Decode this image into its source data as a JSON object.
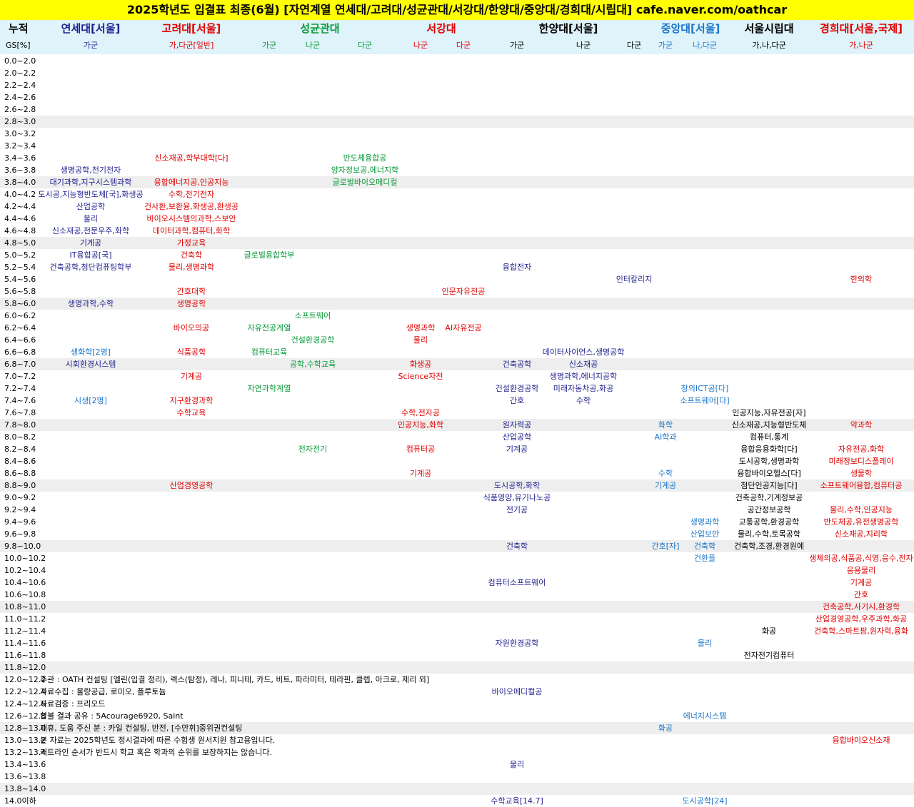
{
  "title": "2025학년도 입결표 최종(6월) [자연계열 연세대/고려대/성균관대/서강대/한양대/중앙대/경희대/시립대] cafe.naver.com/oathcar",
  "header": {
    "cumulative_label": "누적",
    "gs_label": "GS[%]",
    "universities": [
      {
        "key": "yonsei",
        "name": "연세대[서울]",
        "color": "#1f1f8f"
      },
      {
        "key": "korea",
        "name": "고려대[서울]",
        "color": "#e00000"
      },
      {
        "key": "skku",
        "name": "성균관대",
        "color": "#0a9a3a"
      },
      {
        "key": "sogang",
        "name": "서강대",
        "color": "#e00000"
      },
      {
        "key": "hanyang",
        "name": "한양대[서울]",
        "color": "#000000"
      },
      {
        "key": "chungang",
        "name": "중앙대[서울]",
        "color": "#1a75c9"
      },
      {
        "key": "uos",
        "name": "서울시립대",
        "color": "#000000"
      },
      {
        "key": "kyunghee",
        "name": "경희대[서울,국제]",
        "color": "#e00000"
      }
    ],
    "groups": [
      {
        "key": "yonsei_ga",
        "label": "가군"
      },
      {
        "key": "korea_ga",
        "label": "가,다군[일반]"
      },
      {
        "key": "skku_ga",
        "label": "가군"
      },
      {
        "key": "skku_na",
        "label": "나군"
      },
      {
        "key": "skku_da",
        "label": "다군"
      },
      {
        "key": "sogang_na",
        "label": "나군"
      },
      {
        "key": "sogang_da",
        "label": "다군"
      },
      {
        "key": "hanyang_ga",
        "label": "가군"
      },
      {
        "key": "hanyang_na",
        "label": "나군"
      },
      {
        "key": "hanyang_da",
        "label": "다군"
      },
      {
        "key": "chungang_ga",
        "label": "가군"
      },
      {
        "key": "chungang_nada",
        "label": "나,다군"
      },
      {
        "key": "uos",
        "label": "가,나,다군"
      },
      {
        "key": "kyunghee",
        "label": "가,나군"
      }
    ]
  },
  "ranges": [
    "0.0~2.0",
    "2.0~2.2",
    "2.2~2.4",
    "2.4~2.6",
    "2.6~2.8",
    "2.8~3.0",
    "3.0~3.2",
    "3.2~3.4",
    "3.4~3.6",
    "3.6~3.8",
    "3.8~4.0",
    "4.0~4.2",
    "4.2~4.4",
    "4.4~4.6",
    "4.6~4.8",
    "4.8~5.0",
    "5.0~5.2",
    "5.2~5.4",
    "5.4~5.6",
    "5.6~5.8",
    "5.8~6.0",
    "6.0~6.2",
    "6.2~6.4",
    "6.4~6.6",
    "6.6~6.8",
    "6.8~7.0",
    "7.0~7.2",
    "7.2~7.4",
    "7.4~7.6",
    "7.6~7.8",
    "7.8~8.0",
    "8.0~8.2",
    "8.2~8.4",
    "8.4~8.6",
    "8.6~8.8",
    "8.8~9.0",
    "9.0~9.2",
    "9.2~9.4",
    "9.4~9.6",
    "9.6~9.8",
    "9.8~10.0",
    "10.0~10.2",
    "10.2~10.4",
    "10.4~10.6",
    "10.6~10.8",
    "10.8~11.0",
    "11.0~11.2",
    "11.2~11.4",
    "11.4~11.6",
    "11.6~11.8",
    "11.8~12.0",
    "12.0~12.2",
    "12.2~12.4",
    "12.4~12.6",
    "12.6~12.8",
    "12.8~13.0",
    "13.0~13.2",
    "13.2~13.4",
    "13.4~13.6",
    "13.6~13.8",
    "13.8~14.0",
    "14.0이하"
  ],
  "shaded_rows": [
    5,
    10,
    15,
    20,
    25,
    30,
    35,
    40,
    45,
    50,
    55,
    60
  ],
  "cells": [
    {
      "row": 8,
      "col": "korea_ga",
      "text": "신소재공,학부대학[다]",
      "color": "#e00000"
    },
    {
      "row": 8,
      "col": "skku_da",
      "text": "반도체융합공",
      "color": "#0a9a3a"
    },
    {
      "row": 9,
      "col": "yonsei_ga",
      "text": "생명공학,전기전자",
      "color": "#1f1f8f"
    },
    {
      "row": 9,
      "col": "skku_da",
      "text": "양자정보공,에너지학",
      "color": "#0a9a3a"
    },
    {
      "row": 10,
      "col": "yonsei_ga",
      "text": "대기과학,지구시스템과학",
      "color": "#1f1f8f"
    },
    {
      "row": 10,
      "col": "korea_ga",
      "text": "융합에너지공,인공지능",
      "color": "#e00000"
    },
    {
      "row": 10,
      "col": "skku_da",
      "text": "글로벌바이오메디컬",
      "color": "#0a9a3a"
    },
    {
      "row": 11,
      "col": "yonsei_ga",
      "text": "도시공,지능형반도체[국],화생공",
      "color": "#1f1f8f"
    },
    {
      "row": 11,
      "col": "korea_ga",
      "text": "수학,전기전자",
      "color": "#e00000"
    },
    {
      "row": 12,
      "col": "yonsei_ga",
      "text": "산업공학",
      "color": "#1f1f8f"
    },
    {
      "row": 12,
      "col": "korea_ga",
      "text": "건사환,보환융,화생공,환생공",
      "color": "#e00000"
    },
    {
      "row": 13,
      "col": "yonsei_ga",
      "text": "물리",
      "color": "#1f1f8f"
    },
    {
      "row": 13,
      "col": "korea_ga",
      "text": "바이오시스템의과학,스보안",
      "color": "#e00000"
    },
    {
      "row": 14,
      "col": "yonsei_ga",
      "text": "신소재공,천문우주,화학",
      "color": "#1f1f8f"
    },
    {
      "row": 14,
      "col": "korea_ga",
      "text": "데이터과학,컴퓨터,화학",
      "color": "#e00000"
    },
    {
      "row": 15,
      "col": "yonsei_ga",
      "text": "기계공",
      "color": "#1f1f8f"
    },
    {
      "row": 15,
      "col": "korea_ga",
      "text": "가정교육",
      "color": "#e00000"
    },
    {
      "row": 16,
      "col": "yonsei_ga",
      "text": "IT융합공[국]",
      "color": "#1f1f8f"
    },
    {
      "row": 16,
      "col": "korea_ga",
      "text": "건축학",
      "color": "#e00000"
    },
    {
      "row": 16,
      "col": "skku_ga",
      "text": "글로벌융합학부",
      "color": "#0a9a3a"
    },
    {
      "row": 17,
      "col": "yonsei_ga",
      "text": "건축공학,첨단컴퓨팅학부",
      "color": "#1f1f8f"
    },
    {
      "row": 17,
      "col": "korea_ga",
      "text": "물리,생명과학",
      "color": "#e00000"
    },
    {
      "row": 17,
      "col": "hanyang_ga",
      "text": "융합전자",
      "color": "#1f1f8f"
    },
    {
      "row": 18,
      "col": "hanyang_da",
      "text": "인터칼리지",
      "color": "#1f1f8f"
    },
    {
      "row": 18,
      "col": "kyunghee",
      "text": "한의학",
      "color": "#e00000"
    },
    {
      "row": 19,
      "col": "korea_ga",
      "text": "간호대학",
      "color": "#e00000"
    },
    {
      "row": 19,
      "col": "sogang_da",
      "text": "인문자유전공",
      "color": "#e00000"
    },
    {
      "row": 20,
      "col": "yonsei_ga",
      "text": "생명과학,수학",
      "color": "#1f1f8f"
    },
    {
      "row": 20,
      "col": "korea_ga",
      "text": "생명공학",
      "color": "#e00000"
    },
    {
      "row": 21,
      "col": "skku_na",
      "text": "소프트웨어",
      "color": "#0a9a3a"
    },
    {
      "row": 22,
      "col": "korea_ga",
      "text": "바이오의공",
      "color": "#e00000"
    },
    {
      "row": 22,
      "col": "skku_ga",
      "text": "자유전공계열",
      "color": "#0a9a3a"
    },
    {
      "row": 22,
      "col": "sogang_na",
      "text": "생명과학",
      "color": "#e00000"
    },
    {
      "row": 22,
      "col": "sogang_da",
      "text": "AI자유전공",
      "color": "#e00000"
    },
    {
      "row": 23,
      "col": "skku_na",
      "text": "건설환경공학",
      "color": "#0a9a3a"
    },
    {
      "row": 23,
      "col": "sogang_na",
      "text": "물리",
      "color": "#e00000"
    },
    {
      "row": 24,
      "col": "yonsei_ga",
      "text": "생화학[2명]",
      "color": "#1a75c9"
    },
    {
      "row": 24,
      "col": "korea_ga",
      "text": "식품공학",
      "color": "#e00000"
    },
    {
      "row": 24,
      "col": "skku_ga",
      "text": "컴퓨터교육",
      "color": "#0a9a3a"
    },
    {
      "row": 24,
      "col": "hanyang_na",
      "text": "데이터사이언스,생명공학",
      "color": "#1f1f8f"
    },
    {
      "row": 25,
      "col": "yonsei_ga",
      "text": "시회환경시스템",
      "color": "#1f1f8f"
    },
    {
      "row": 25,
      "col": "skku_na",
      "text": "공학,수학교육",
      "color": "#0a9a3a"
    },
    {
      "row": 25,
      "col": "sogang_na",
      "text": "화생공",
      "color": "#e00000"
    },
    {
      "row": 25,
      "col": "hanyang_ga",
      "text": "건축공학",
      "color": "#1f1f8f"
    },
    {
      "row": 25,
      "col": "hanyang_na",
      "text": "신소재공",
      "color": "#1f1f8f"
    },
    {
      "row": 26,
      "col": "korea_ga",
      "text": "기계공",
      "color": "#e00000"
    },
    {
      "row": 26,
      "col": "sogang_na",
      "text": "Science자전",
      "color": "#e00000"
    },
    {
      "row": 26,
      "col": "hanyang_na",
      "text": "생명과학,에너지공학",
      "color": "#1f1f8f"
    },
    {
      "row": 27,
      "col": "skku_ga",
      "text": "자연과학계열",
      "color": "#0a9a3a"
    },
    {
      "row": 27,
      "col": "hanyang_ga",
      "text": "건설환경공학",
      "color": "#1f1f8f"
    },
    {
      "row": 27,
      "col": "hanyang_na",
      "text": "미래자동차공,화공",
      "color": "#1f1f8f"
    },
    {
      "row": 27,
      "col": "chungang_nada",
      "text": "창의ICT공[다]",
      "color": "#1a75c9"
    },
    {
      "row": 28,
      "col": "yonsei_ga",
      "text": "시생[2명]",
      "color": "#1a75c9"
    },
    {
      "row": 28,
      "col": "korea_ga",
      "text": "지구환경과학",
      "color": "#e00000"
    },
    {
      "row": 28,
      "col": "hanyang_ga",
      "text": "간호",
      "color": "#1f1f8f"
    },
    {
      "row": 28,
      "col": "hanyang_na",
      "text": "수학",
      "color": "#1f1f8f"
    },
    {
      "row": 28,
      "col": "chungang_nada",
      "text": "소프트웨어[다]",
      "color": "#1a75c9"
    },
    {
      "row": 29,
      "col": "korea_ga",
      "text": "수학교육",
      "color": "#e00000"
    },
    {
      "row": 29,
      "col": "sogang_na",
      "text": "수학,전자공",
      "color": "#e00000"
    },
    {
      "row": 29,
      "col": "uos",
      "text": "인공지능,자유전공[자]",
      "color": "#000000"
    },
    {
      "row": 30,
      "col": "sogang_na",
      "text": "인공지능,화학",
      "color": "#e00000"
    },
    {
      "row": 30,
      "col": "hanyang_ga",
      "text": "원자력공",
      "color": "#1f1f8f"
    },
    {
      "row": 30,
      "col": "chungang_ga",
      "text": "화학",
      "color": "#1a75c9"
    },
    {
      "row": 30,
      "col": "uos",
      "text": "신소재공,지능형반도체",
      "color": "#000000"
    },
    {
      "row": 30,
      "col": "kyunghee",
      "text": "약과학",
      "color": "#e00000"
    },
    {
      "row": 31,
      "col": "hanyang_ga",
      "text": "산업공학",
      "color": "#1f1f8f"
    },
    {
      "row": 31,
      "col": "chungang_ga",
      "text": "AI학과",
      "color": "#1a75c9"
    },
    {
      "row": 31,
      "col": "uos",
      "text": "컴퓨터,통계",
      "color": "#000000"
    },
    {
      "row": 32,
      "col": "skku_na",
      "text": "전자전기",
      "color": "#0a9a3a"
    },
    {
      "row": 32,
      "col": "sogang_na",
      "text": "컴퓨터공",
      "color": "#e00000"
    },
    {
      "row": 32,
      "col": "hanyang_ga",
      "text": "기계공",
      "color": "#1f1f8f"
    },
    {
      "row": 32,
      "col": "uos",
      "text": "융합응용화학[다]",
      "color": "#000000"
    },
    {
      "row": 32,
      "col": "kyunghee",
      "text": "자유전공,화학",
      "color": "#e00000"
    },
    {
      "row": 33,
      "col": "uos",
      "text": "도시공학,생명과학",
      "color": "#000000"
    },
    {
      "row": 33,
      "col": "kyunghee",
      "text": "미래정보디스플레이",
      "color": "#e00000"
    },
    {
      "row": 34,
      "col": "sogang_na",
      "text": "기계공",
      "color": "#e00000"
    },
    {
      "row": 34,
      "col": "chungang_ga",
      "text": "수학",
      "color": "#1a75c9"
    },
    {
      "row": 34,
      "col": "uos",
      "text": "융합바이오헬스[다]",
      "color": "#000000"
    },
    {
      "row": 34,
      "col": "kyunghee",
      "text": "생물학",
      "color": "#e00000"
    },
    {
      "row": 35,
      "col": "korea_ga",
      "text": "산업경영공학",
      "color": "#e00000"
    },
    {
      "row": 35,
      "col": "hanyang_ga",
      "text": "도시공학,화학",
      "color": "#1f1f8f"
    },
    {
      "row": 35,
      "col": "chungang_ga",
      "text": "기계공",
      "color": "#1a75c9"
    },
    {
      "row": 35,
      "col": "uos",
      "text": "첨단인공지능[다]",
      "color": "#000000"
    },
    {
      "row": 35,
      "col": "kyunghee",
      "text": "소프트웨어융합,컴퓨터공",
      "color": "#e00000"
    },
    {
      "row": 36,
      "col": "hanyang_ga",
      "text": "식품영양,유기나노공",
      "color": "#1f1f8f"
    },
    {
      "row": 36,
      "col": "uos",
      "text": "건축공학,기계정보공",
      "color": "#000000"
    },
    {
      "row": 37,
      "col": "hanyang_ga",
      "text": "전기공",
      "color": "#1f1f8f"
    },
    {
      "row": 37,
      "col": "uos",
      "text": "공간정보공학",
      "color": "#000000"
    },
    {
      "row": 37,
      "col": "kyunghee",
      "text": "물리,수학,인공지능",
      "color": "#e00000"
    },
    {
      "row": 38,
      "col": "chungang_nada",
      "text": "생명과학",
      "color": "#1a75c9"
    },
    {
      "row": 38,
      "col": "uos",
      "text": "교통공학,환경공학",
      "color": "#000000"
    },
    {
      "row": 38,
      "col": "kyunghee",
      "text": "반도체공,유전생명공학",
      "color": "#e00000"
    },
    {
      "row": 39,
      "col": "chungang_nada",
      "text": "산업보안",
      "color": "#1a75c9"
    },
    {
      "row": 39,
      "col": "uos",
      "text": "물리,수학,토목공학",
      "color": "#000000"
    },
    {
      "row": 39,
      "col": "kyunghee",
      "text": "신소재공,지리학",
      "color": "#e00000"
    },
    {
      "row": 40,
      "col": "hanyang_ga",
      "text": "건축학",
      "color": "#1f1f8f"
    },
    {
      "row": 40,
      "col": "chungang_ga",
      "text": "간호[자]",
      "color": "#1a75c9"
    },
    {
      "row": 40,
      "col": "chungang_nada",
      "text": "건축학",
      "color": "#1a75c9"
    },
    {
      "row": 40,
      "col": "uos",
      "text": "건축학,조경,환경원예",
      "color": "#000000"
    },
    {
      "row": 41,
      "col": "chungang_nada",
      "text": "건환플",
      "color": "#1a75c9"
    },
    {
      "row": 41,
      "col": "kyunghee",
      "text": "생체의공,식품공,식영,응수,전자",
      "color": "#e00000"
    },
    {
      "row": 42,
      "col": "kyunghee",
      "text": "응용물리",
      "color": "#e00000"
    },
    {
      "row": 43,
      "col": "hanyang_ga",
      "text": "컴퓨터소프트웨어",
      "color": "#1f1f8f"
    },
    {
      "row": 43,
      "col": "kyunghee",
      "text": "기계공",
      "color": "#e00000"
    },
    {
      "row": 44,
      "col": "kyunghee",
      "text": "간호",
      "color": "#e00000"
    },
    {
      "row": 45,
      "col": "kyunghee",
      "text": "건축공학,사기시,환경학",
      "color": "#e00000"
    },
    {
      "row": 46,
      "col": "kyunghee",
      "text": "산업경영공학,우주과학,화공",
      "color": "#e00000"
    },
    {
      "row": 47,
      "col": "uos",
      "text": "화공",
      "color": "#000000"
    },
    {
      "row": 47,
      "col": "kyunghee",
      "text": "건축학,스마트팜,원자력,융화",
      "color": "#e00000"
    },
    {
      "row": 48,
      "col": "hanyang_ga",
      "text": "자원환경공학",
      "color": "#1f1f8f"
    },
    {
      "row": 48,
      "col": "chungang_nada",
      "text": "물리",
      "color": "#1a75c9"
    },
    {
      "row": 49,
      "col": "uos",
      "text": "전자전기컴퓨터",
      "color": "#000000"
    },
    {
      "row": 52,
      "col": "hanyang_ga",
      "text": "바이오메디컬공",
      "color": "#1f1f8f"
    },
    {
      "row": 54,
      "col": "chungang_nada",
      "text": "에너지시스템",
      "color": "#1a75c9"
    },
    {
      "row": 55,
      "col": "chungang_ga",
      "text": "화공",
      "color": "#1a75c9"
    },
    {
      "row": 56,
      "col": "kyunghee",
      "text": "융합바이오신소재",
      "color": "#e00000"
    },
    {
      "row": 58,
      "col": "hanyang_ga",
      "text": "물리",
      "color": "#1f1f8f"
    },
    {
      "row": 61,
      "col": "hanyang_ga",
      "text": "수학교육[14.7]",
      "color": "#1f1f8f"
    },
    {
      "row": 61,
      "col": "chungang_nada",
      "text": "도시공학[24]",
      "color": "#1a75c9"
    }
  ],
  "notes": [
    {
      "row": 51,
      "text": "주관 : OATH 컨설팅 [엘린(입결 정리), 렉스(탐정), 레나, 피니테, 카드, 비트, 파라미터, 테라핀, 클렙, 아크로, 제리 외]"
    },
    {
      "row": 52,
      "text": "자료수집 : 물량공급, 로미오, 플루토늄"
    },
    {
      "row": 53,
      "text": "자료검증 : 프리오드"
    },
    {
      "row": 54,
      "text": "합불 결과 공유 : 5Acourage6920, Saint"
    },
    {
      "row": 55,
      "text": "제휴, 도움 주신 분 : 카일 컨설팅, 반전, [수만휘]중위권컨설팅"
    },
    {
      "row": 56,
      "text": "본 자료는 2025학년도 정시결과에 따른 수험생 원서지원 참고용입니다."
    },
    {
      "row": 57,
      "text": "커트라인 순서가 반드시 학교 혹은 학과의 순위를 보장하지는 않습니다."
    }
  ]
}
